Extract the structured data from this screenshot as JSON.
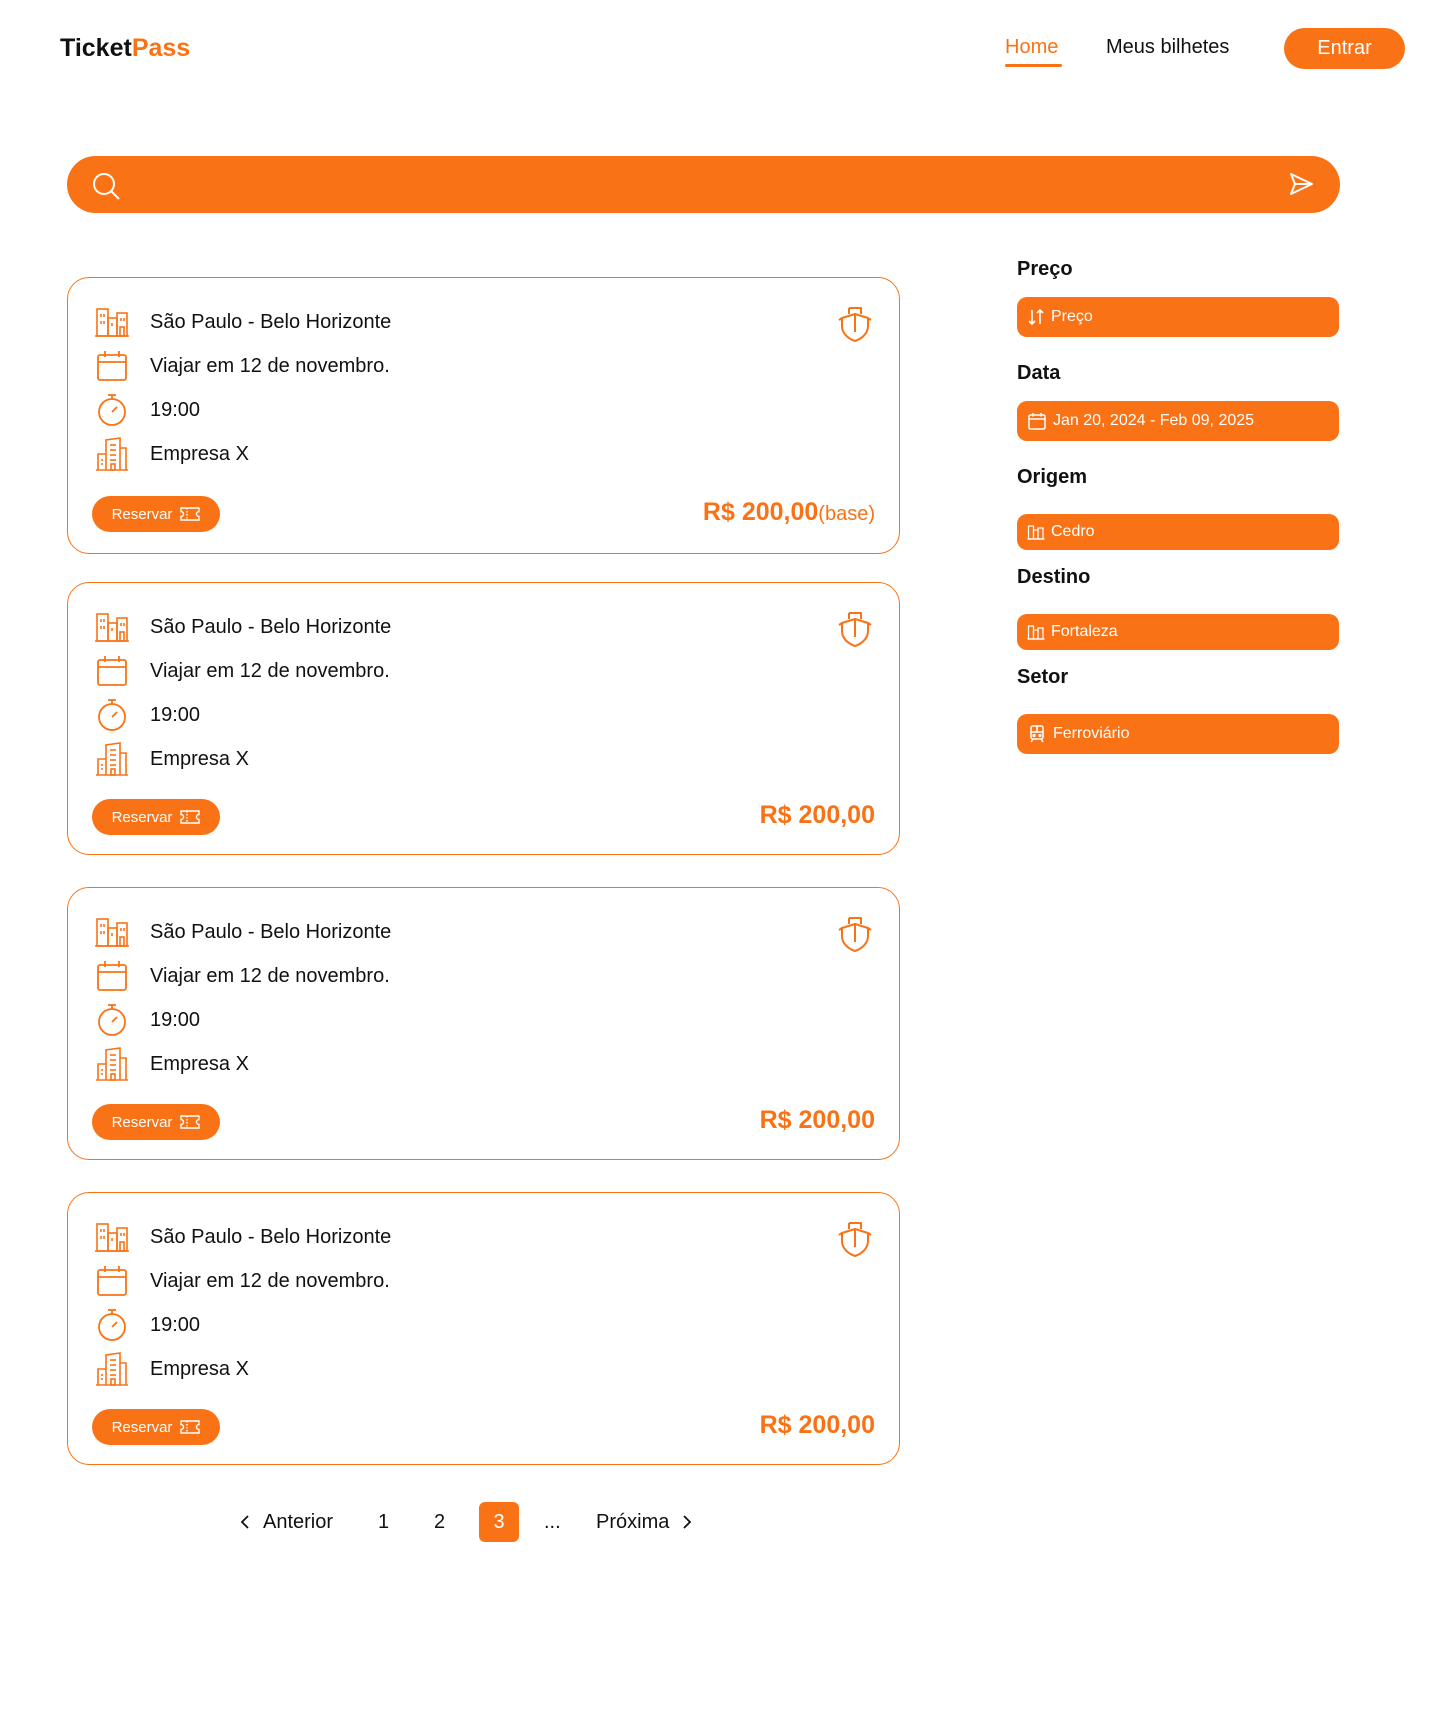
{
  "header": {
    "logo_part1": "Ticket",
    "logo_part2": "Pass",
    "nav": {
      "home": "Home",
      "tickets": "Meus bilhetes"
    },
    "login_button": "Entrar"
  },
  "search": {
    "placeholder": "",
    "value": ""
  },
  "results": [
    {
      "route": "São Paulo - Belo Horizonte",
      "date": "Viajar em 12 de novembro.",
      "time": "19:00",
      "company": "Empresa X",
      "reserve_label": "Reservar",
      "price": "R$ 200,00",
      "price_note": "(base)"
    },
    {
      "route": "São Paulo - Belo Horizonte",
      "date": "Viajar em 12 de novembro.",
      "time": "19:00",
      "company": "Empresa X",
      "reserve_label": "Reservar",
      "price": "R$ 200,00",
      "price_note": ""
    },
    {
      "route": "São Paulo - Belo Horizonte",
      "date": "Viajar em 12 de novembro.",
      "time": "19:00",
      "company": "Empresa X",
      "reserve_label": "Reservar",
      "price": "R$ 200,00",
      "price_note": ""
    },
    {
      "route": "São Paulo - Belo Horizonte",
      "date": "Viajar em 12 de novembro.",
      "time": "19:00",
      "company": "Empresa X",
      "reserve_label": "Reservar",
      "price": "R$ 200,00",
      "price_note": ""
    }
  ],
  "pagination": {
    "prev": "Anterior",
    "pages": [
      "1",
      "2",
      "3"
    ],
    "current": "3",
    "ellipsis": "...",
    "next": "Próxima"
  },
  "filters": {
    "price": {
      "label": "Preço",
      "value": "Preço"
    },
    "date": {
      "label": "Data",
      "value": "Jan 20, 2024 - Feb 09, 2025"
    },
    "origin": {
      "label": "Origem",
      "value": "Cedro"
    },
    "destination": {
      "label": "Destino",
      "value": "Fortaleza"
    },
    "sector": {
      "label": "Setor",
      "value": "Ferroviário"
    }
  },
  "colors": {
    "accent": "#F97316",
    "text": "#111111",
    "background": "#FFFFFF"
  }
}
